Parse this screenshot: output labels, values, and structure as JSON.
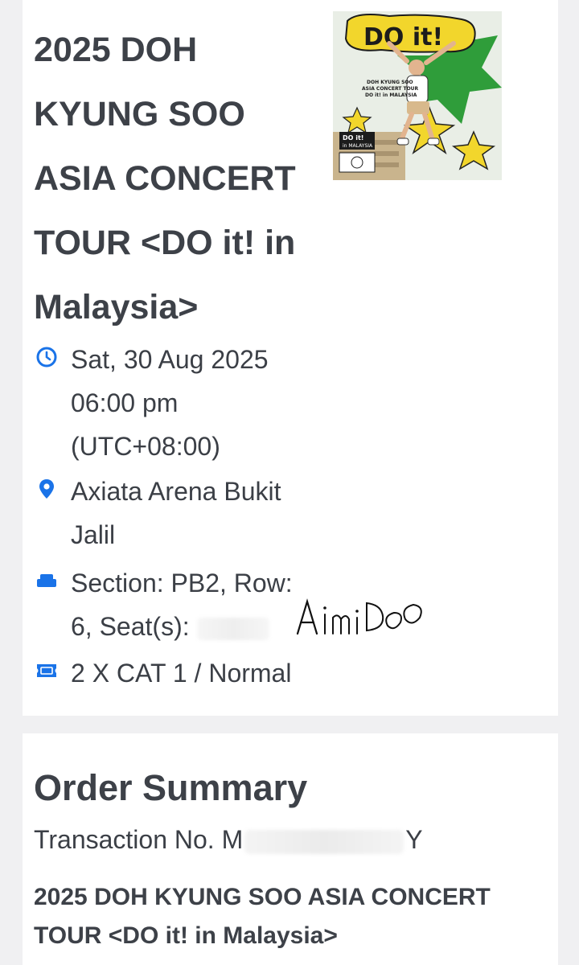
{
  "event": {
    "title": "2025 DOH KYUNG SOO ASIA CONCERT TOUR <DO it! in Malaysia>",
    "poster": {
      "logo_text": "DO it!",
      "tour_line_1": "DOH KYUNG SOO",
      "tour_line_2": "ASIA CONCERT TOUR",
      "tour_line_3": "DO it! in MALAYSIA",
      "badge_line_1": "DO it!",
      "badge_line_2": "in MALAYSIA"
    }
  },
  "details": {
    "datetime": {
      "icon": "clock-icon",
      "line1": "Sat, 30 Aug 2025",
      "line2": "06:00 pm",
      "line3": "(UTC+08:00)"
    },
    "venue": {
      "icon": "map-pin-icon",
      "line1": "Axiata Arena Bukit",
      "line2": "Jalil"
    },
    "seat": {
      "icon": "seat-sofa-icon",
      "line1": "Section: PB2, Row:",
      "line2": "6, Seat(s):"
    },
    "ticket": {
      "icon": "ticket-icon",
      "text": "2 X CAT 1 / Normal"
    },
    "watermark_text": "AimiDOO"
  },
  "order_summary": {
    "title": "Order Summary",
    "transaction_prefix": "Transaction No. M",
    "transaction_suffix": "Y",
    "event_title": "2025 DOH KYUNG SOO ASIA CONCERT TOUR <DO it! in Malaysia>"
  },
  "colors": {
    "accent_blue": "#1a73e8",
    "text_dark": "#3d4148",
    "background": "#f0f0f2",
    "card": "#ffffff",
    "poster_yellow": "#f2d62c",
    "poster_green": "#2f9d3a"
  }
}
